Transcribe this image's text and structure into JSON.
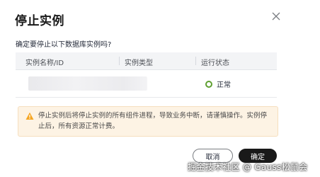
{
  "dialog": {
    "title": "停止实例",
    "prompt": "确定要停止以下数据库实例吗?"
  },
  "table": {
    "columns": [
      "实例名称/ID",
      "实例类型",
      "运行状态"
    ],
    "rows": [
      {
        "name": "",
        "type": "",
        "status": "正常"
      }
    ]
  },
  "warning": {
    "text": "停止实例后将停止实例的所有组件进程，导致业务中断，请谨慎操作。实例停止后，所有资源正常计费。",
    "icon": "warning-triangle-icon",
    "accent": "#f5a623"
  },
  "buttons": {
    "cancel": "取消",
    "confirm": "确定"
  },
  "watermark": "掘金技术社区 @ Gauss松鼠会",
  "colors": {
    "status_ok": "#5e9f30",
    "primary_button": "#191919"
  }
}
